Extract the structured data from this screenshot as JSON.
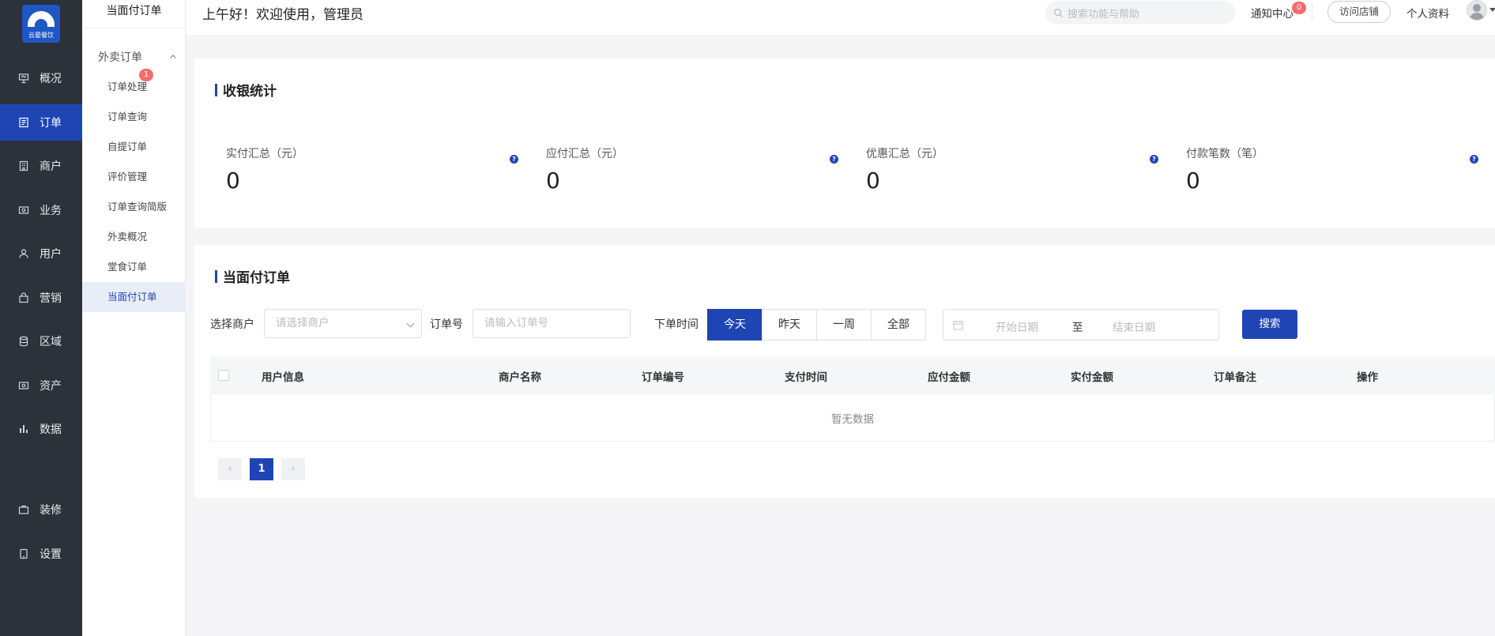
{
  "app": {
    "logo_text": "云晏餐饮"
  },
  "nav": [
    {
      "label": "概况",
      "icon": "presentation-icon"
    },
    {
      "label": "订单",
      "icon": "order-icon"
    },
    {
      "label": "商户",
      "icon": "building-icon"
    },
    {
      "label": "业务",
      "icon": "wallet-icon"
    },
    {
      "label": "用户",
      "icon": "user-icon"
    },
    {
      "label": "营销",
      "icon": "bag-icon"
    },
    {
      "label": "区域",
      "icon": "database-icon"
    },
    {
      "label": "资产",
      "icon": "wallet-icon"
    },
    {
      "label": "数据",
      "icon": "bar-chart-icon"
    },
    {
      "label": "装修",
      "icon": "briefcase-icon"
    },
    {
      "label": "设置",
      "icon": "tablet-icon"
    }
  ],
  "submenu": {
    "title": "当面付订单",
    "group": "外卖订单",
    "group_badge": "1",
    "items": [
      "订单处理",
      "订单查询",
      "自提订单",
      "评价管理",
      "订单查询简版",
      "外卖概况",
      "堂食订单",
      "当面付订单"
    ]
  },
  "header": {
    "greeting": "上午好！欢迎使用，管理员",
    "search_placeholder": "搜索功能与帮助",
    "notify": "通知中心",
    "notify_count": "0",
    "visit_store": "访问店铺",
    "profile": "个人资料"
  },
  "stats": {
    "title": "收银统计",
    "items": [
      {
        "label": "实付汇总（元）",
        "value": "0"
      },
      {
        "label": "应付汇总（元）",
        "value": "0"
      },
      {
        "label": "优惠汇总（元）",
        "value": "0"
      },
      {
        "label": "付款笔数（笔）",
        "value": "0"
      }
    ],
    "help_icon": "?"
  },
  "orders": {
    "title": "当面付订单",
    "merchant_label": "选择商户",
    "merchant_placeholder": "请选择商户",
    "order_no_label": "订单号",
    "order_no_placeholder": "请输入订单号",
    "time_label": "下单时间",
    "time_options": [
      "今天",
      "昨天",
      "一周",
      "全部"
    ],
    "time_selected": "今天",
    "start_placeholder": "开始日期",
    "range_sep": "至",
    "end_placeholder": "结束日期",
    "search_button": "搜索",
    "columns": [
      "用户信息",
      "商户名称",
      "订单编号",
      "支付时间",
      "应付金额",
      "实付金额",
      "订单备注",
      "操作"
    ],
    "empty_text": "暂无数据",
    "pager": {
      "prev": "‹",
      "current": "1",
      "next": "›"
    }
  }
}
